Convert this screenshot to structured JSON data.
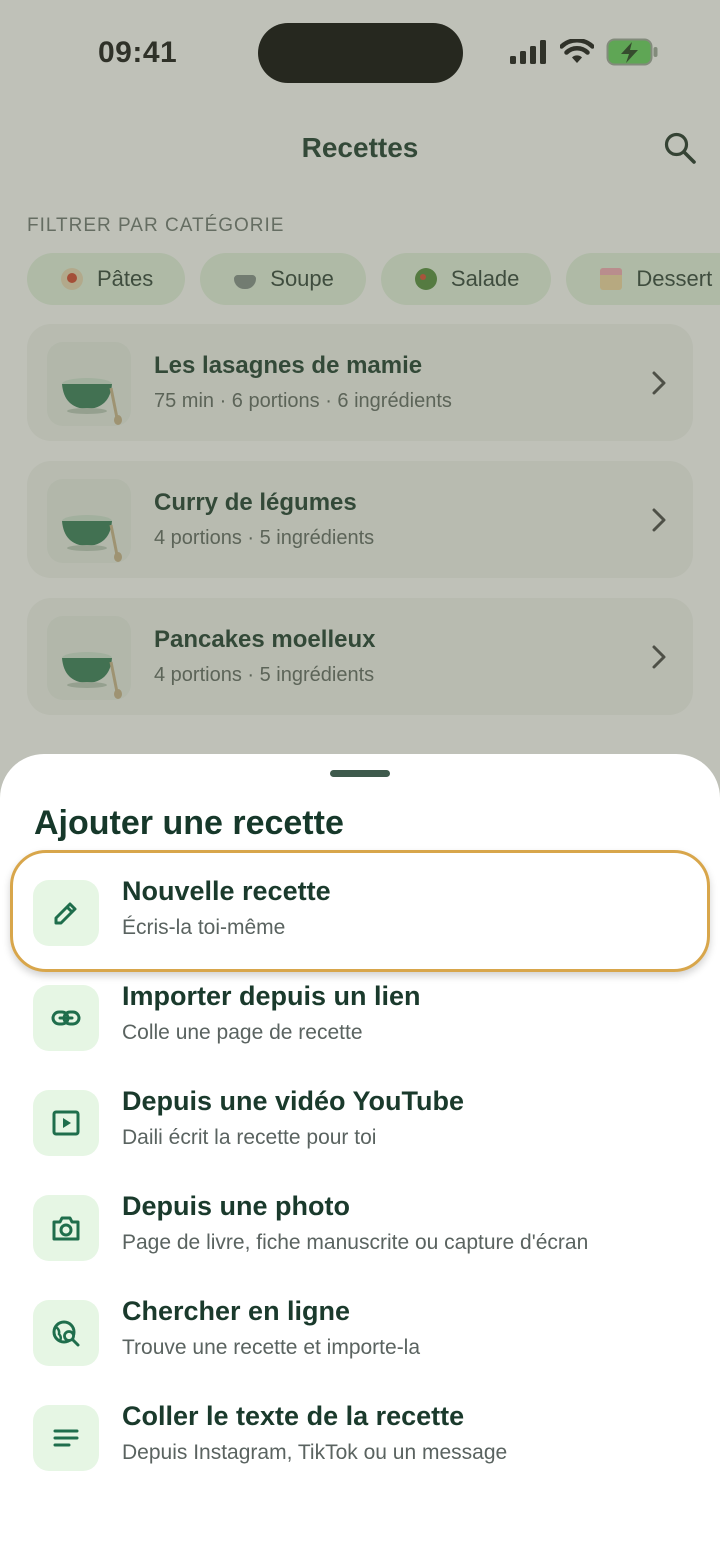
{
  "status_bar": {
    "time": "09:41"
  },
  "header": {
    "title": "Recettes",
    "search_icon": "search-icon"
  },
  "filters": {
    "label": "FILTRER PAR CATÉGORIE",
    "chips": [
      {
        "label": "Pâtes"
      },
      {
        "label": "Soupe"
      },
      {
        "label": "Salade"
      },
      {
        "label": "Dessert"
      }
    ]
  },
  "recipes": [
    {
      "title": "Les lasagnes de mamie",
      "meta": "75 min · 6 portions · 6 ingrédients"
    },
    {
      "title": "Curry de légumes",
      "meta": "4 portions · 5 ingrédients"
    },
    {
      "title": "Pancakes moelleux",
      "meta": "4 portions · 5 ingrédients"
    }
  ],
  "sheet": {
    "title": "Ajouter une recette",
    "options": [
      {
        "title": "Nouvelle recette",
        "subtitle": "Écris-la toi-même",
        "icon": "pencil-icon"
      },
      {
        "title": "Importer depuis un lien",
        "subtitle": "Colle une page de recette",
        "icon": "link-icon"
      },
      {
        "title": "Depuis une vidéo YouTube",
        "subtitle": "Daili écrit la recette pour toi",
        "icon": "video-icon"
      },
      {
        "title": "Depuis une photo",
        "subtitle": "Page de livre, fiche manuscrite ou capture d'écran",
        "icon": "camera-icon"
      },
      {
        "title": "Chercher en ligne",
        "subtitle": "Trouve une recette et importe-la",
        "icon": "web-search-icon"
      },
      {
        "title": "Coller le texte de la recette",
        "subtitle": "Depuis Instagram, TikTok ou un message",
        "icon": "text-icon"
      }
    ]
  },
  "colors": {
    "accent": "#1f6e4c",
    "highlight": "#d8a64b",
    "chip_bg": "#e4f4e2"
  }
}
